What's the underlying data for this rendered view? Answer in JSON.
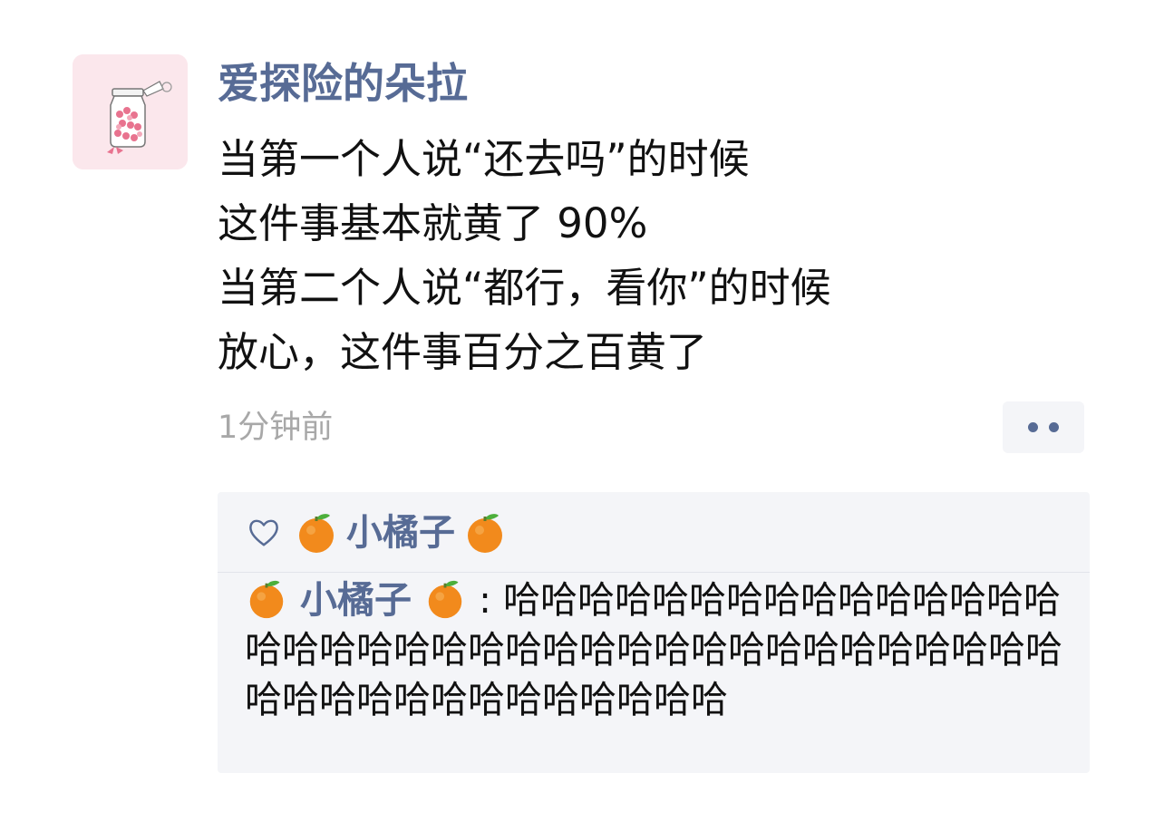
{
  "post": {
    "username": "爱探险的朵拉",
    "lines": [
      "当第一个人说“还去吗”的时候",
      "这件事基本就黄了 90%",
      "当第二个人说“都行，看你”的时候",
      "放心，这件事百分之百黄了"
    ],
    "timestamp": "1分钟前"
  },
  "likes": {
    "name": "小橘子",
    "icon": "heart-outline"
  },
  "comment": {
    "author": "小橘子",
    "separator": ":",
    "text": "哈哈哈哈哈哈哈哈哈哈哈哈哈哈哈哈哈哈哈哈哈哈哈哈哈哈哈哈哈哈哈哈哈哈哈哈哈哈哈哈哈哈哈哈哈哈哈哈哈哈"
  },
  "colors": {
    "link_blue": "#576b95",
    "comment_bg": "#f4f5f8",
    "timestamp_gray": "#a8a8a8",
    "avatar_bg": "#fbe7ec"
  }
}
